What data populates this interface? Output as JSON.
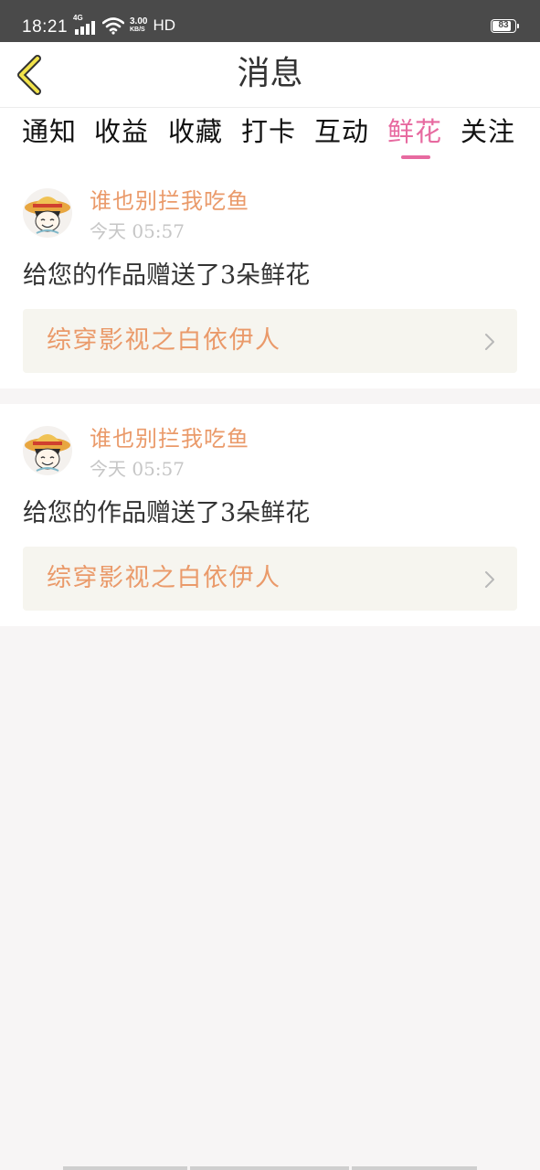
{
  "status_bar": {
    "time": "18:21",
    "network_type": "4G",
    "speed_value": "3.00",
    "speed_unit": "KB/S",
    "hd_label": "HD",
    "battery_level": "83",
    "icons": [
      "signal-icon",
      "wifi-icon",
      "battery-icon"
    ]
  },
  "header": {
    "title": "消息",
    "back_icon": "chevron-left-icon"
  },
  "tabs": [
    {
      "label": "通知",
      "active": false
    },
    {
      "label": "收益",
      "active": false
    },
    {
      "label": "收藏",
      "active": false
    },
    {
      "label": "打卡",
      "active": false
    },
    {
      "label": "互动",
      "active": false
    },
    {
      "label": "鲜花",
      "active": true
    },
    {
      "label": "关注",
      "active": false
    }
  ],
  "messages": [
    {
      "username": "谁也别拦我吃鱼",
      "time": "今天 05:57",
      "text": "给您的作品赠送了3朵鲜花",
      "work_title": "综穿影视之白依伊人",
      "avatar_icon": "avatar-icon",
      "link_icon": "chevron-right-icon"
    },
    {
      "username": "谁也别拦我吃鱼",
      "time": "今天 05:57",
      "text": "给您的作品赠送了3朵鲜花",
      "work_title": "综穿影视之白依伊人",
      "avatar_icon": "avatar-icon",
      "link_icon": "chevron-right-icon"
    }
  ],
  "colors": {
    "status_bar_bg": "#4a4a4a",
    "accent_pink": "#e76aa0",
    "accent_orange": "#ea9a6a",
    "back_icon_yellow": "#f2e34a",
    "page_bg": "#f7f5f5",
    "link_bg": "#f6f5ef",
    "text_dark": "#333333",
    "text_muted": "#c6c6c6"
  }
}
